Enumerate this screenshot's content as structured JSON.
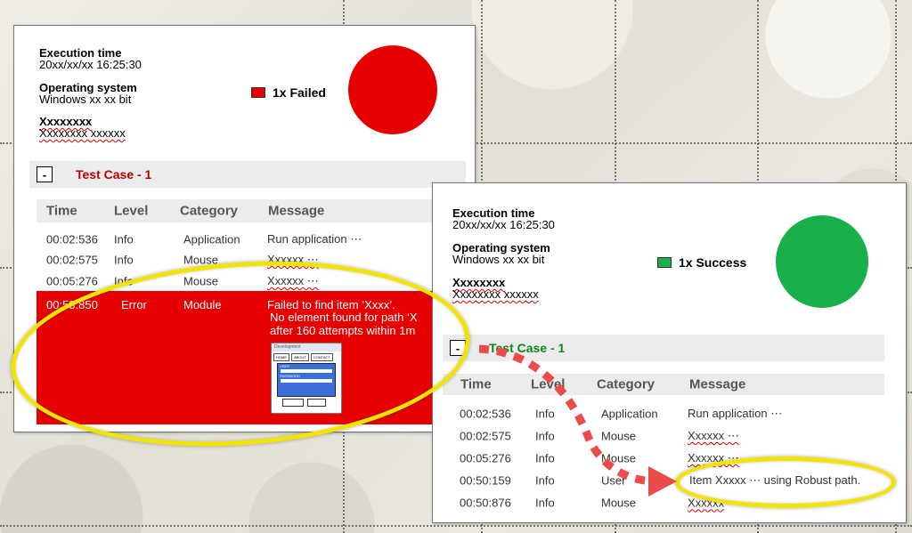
{
  "colors": {
    "failed": "#e60000",
    "success": "#19b04c",
    "tc_failed": "#b80000",
    "tc_success": "#0a8a1a",
    "highlight": "#f2e300"
  },
  "failed_panel": {
    "execution_time_label": "Execution time",
    "execution_time_value": "20xx/xx/xx 16:25:30",
    "os_label": "Operating system",
    "os_value": "Windows xx xx bit",
    "extra_label": "Xxxxxxxx",
    "extra_value": "Xxxxxxxx xxxxxx",
    "status_label": "1x Failed",
    "status_icon": "red-square-icon",
    "test_case": {
      "toggle": "-",
      "title": "Test Case - 1"
    },
    "columns": [
      "Time",
      "Level",
      "Category",
      "Message"
    ],
    "rows": [
      {
        "time": "00:02:536",
        "level": "Info",
        "category": "Application",
        "message": "Run application  ⋯"
      },
      {
        "time": "00:02:575",
        "level": "Info",
        "category": "Mouse",
        "message": "Xxxxxx ⋯"
      },
      {
        "time": "00:05:276",
        "level": "Info",
        "category": "Mouse",
        "message": "Xxxxxx ⋯"
      }
    ],
    "error_row": {
      "time": "00:53:850",
      "level": "Error",
      "category": "Module",
      "message_line1": "Failed to find item ‘Xxxx’.",
      "message_line2": "No element found for path ‘X",
      "message_line3": "after 160 attempts within 1m"
    },
    "mini_window": {
      "title": "Development",
      "tabs": [
        "HOME",
        "ABOUT",
        "CONTACT"
      ],
      "user_label": "USER",
      "password_label": "PASSWORD",
      "cancel": "CANCEL",
      "login": "LOGIN"
    }
  },
  "success_panel": {
    "execution_time_label": "Execution time",
    "execution_time_value": "20xx/xx/xx 16:25:30",
    "os_label": "Operating system",
    "os_value": "Windows xx xx bit",
    "extra_label": "Xxxxxxxx",
    "extra_value": "Xxxxxxxx xxxxxx",
    "status_label": "1x Success",
    "status_icon": "green-square-icon",
    "test_case": {
      "toggle": "-",
      "title": "Test Case - 1"
    },
    "columns": [
      "Time",
      "Level",
      "Category",
      "Message"
    ],
    "rows": [
      {
        "time": "00:02:536",
        "level": "Info",
        "category": "Application",
        "message": "Run application  ⋯"
      },
      {
        "time": "00:02:575",
        "level": "Info",
        "category": "Mouse",
        "message": "Xxxxxx ⋯"
      },
      {
        "time": "00:05:276",
        "level": "Info",
        "category": "Mouse",
        "message": "Xxxxxx ⋯"
      },
      {
        "time": "00:50:159",
        "level": "Info",
        "category": "User",
        "message": "Item Xxxxx ⋯ using Robust path."
      },
      {
        "time": "00:50:876",
        "level": "Info",
        "category": "Mouse",
        "message": "Xxxxxx"
      }
    ]
  }
}
